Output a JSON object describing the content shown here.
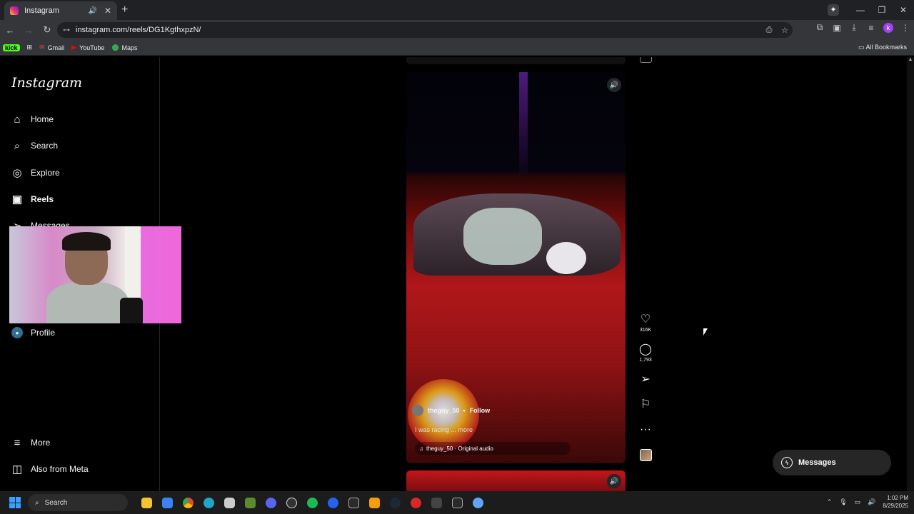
{
  "browser": {
    "tab_title": "Instagram",
    "new_tab": "+",
    "url": "instagram.com/reels/DG1KgthxpzN/",
    "bookmarks": [
      {
        "label": "kick"
      },
      {
        "label": "Gmail"
      },
      {
        "label": "YouTube"
      },
      {
        "label": "Maps"
      }
    ],
    "all_bookmarks": "All Bookmarks",
    "profile_initial": "k"
  },
  "sidebar": {
    "logo": "Instagram",
    "items": [
      {
        "label": "Home",
        "icon": "home-icon"
      },
      {
        "label": "Search",
        "icon": "search-icon"
      },
      {
        "label": "Explore",
        "icon": "compass-icon"
      },
      {
        "label": "Reels",
        "icon": "reels-icon"
      },
      {
        "label": "Messages",
        "icon": "send-icon"
      },
      {
        "label": "Profile",
        "icon": "profile-icon"
      },
      {
        "label": "More",
        "icon": "menu-icon"
      },
      {
        "label": "Also from Meta",
        "icon": "meta-icon"
      }
    ]
  },
  "reel": {
    "username": "theguy_50",
    "follow": "Follow",
    "caption": "I was racing ... more",
    "audio": "theguy_50 · Original audio",
    "likes": "316K",
    "comments": "1,793"
  },
  "messages_button": "Messages",
  "taskbar": {
    "search": "Search",
    "time": "1:02 PM",
    "date": "8/29/2025"
  },
  "colors": {
    "background": "#000000",
    "reel_red": "#b0171a",
    "chrome_dark": "#202124"
  }
}
